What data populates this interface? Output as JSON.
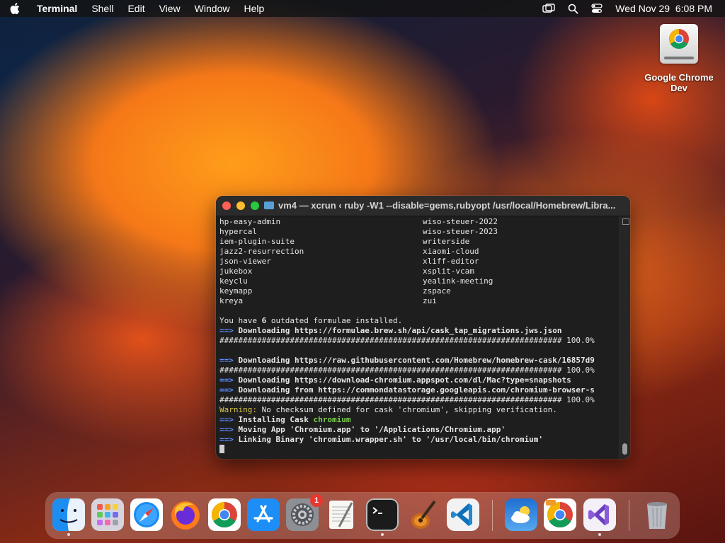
{
  "menubar": {
    "app_name": "Terminal",
    "menus": [
      "Shell",
      "Edit",
      "View",
      "Window",
      "Help"
    ],
    "clock": "Wed Nov 29  6:08 PM"
  },
  "desktop": {
    "icons": [
      {
        "label": "Google Chrome Dev",
        "icon": "chrome-dev-drive-icon"
      }
    ]
  },
  "terminal": {
    "title": "vm4 — xcrun ‹ ruby -W1 --disable=gems,rubyopt /usr/local/Homebrew/Libra...",
    "columns_rows": [
      [
        "hp-easy-admin",
        "wiso-steuer-2022"
      ],
      [
        "hypercal",
        "wiso-steuer-2023"
      ],
      [
        "iem-plugin-suite",
        "writerside"
      ],
      [
        "jazz2-resurrection",
        "xiaomi-cloud"
      ],
      [
        "json-viewer",
        "xliff-editor"
      ],
      [
        "jukebox",
        "xsplit-vcam"
      ],
      [
        "keyclu",
        "yealink-meeting"
      ],
      [
        "keymapp",
        "zspace"
      ],
      [
        "kreya",
        "zui"
      ]
    ],
    "outdated_prefix": "You have ",
    "outdated_count": "6",
    "outdated_suffix": " outdated formulae installed.",
    "arrow": "==>",
    "dl1": "Downloading https://formulae.brew.sh/api/cask_tap_migrations.jws.json",
    "progress_bar": "######################################################################### 100.0%",
    "dl2": "Downloading https://raw.githubusercontent.com/Homebrew/homebrew-cask/16857d9",
    "dl3": "Downloading https://download-chromium.appspot.com/dl/Mac?type=snapshots",
    "dl4": "Downloading from https://commondatastorage.googleapis.com/chromium-browser-s",
    "warning_label": "Warning:",
    "warning_text": " No checksum defined for cask 'chromium', skipping verification.",
    "install_label": "Installing Cask ",
    "install_name": "chromium",
    "moving": "Moving App 'Chromium.app' to '/Applications/Chromium.app'",
    "linking": "Linking Binary 'chromium.wrapper.sh' to '/usr/local/bin/chromium'"
  },
  "dock": {
    "items": [
      {
        "name": "Finder",
        "icon": "finder-icon",
        "running": true
      },
      {
        "name": "Launchpad",
        "icon": "launchpad-icon"
      },
      {
        "name": "Safari",
        "icon": "safari-icon"
      },
      {
        "name": "Firefox",
        "icon": "firefox-icon"
      },
      {
        "name": "Google Chrome",
        "icon": "chrome-icon"
      },
      {
        "name": "App Store",
        "icon": "app-store-icon"
      },
      {
        "name": "System Settings",
        "icon": "settings-icon",
        "badge": "1"
      },
      {
        "name": "TextEdit",
        "icon": "textedit-icon"
      },
      {
        "name": "Terminal",
        "icon": "terminal-icon",
        "running": true
      },
      {
        "name": "GarageBand",
        "icon": "garageband-icon"
      },
      {
        "name": "Visual Studio Code",
        "icon": "vscode-icon"
      },
      {
        "name": "Weather",
        "icon": "weather-icon"
      },
      {
        "name": "Google Chrome Dev",
        "icon": "chrome-dev-icon"
      },
      {
        "name": "Visual Studio",
        "icon": "visual-studio-icon",
        "running": true
      },
      {
        "name": "Trash",
        "icon": "trash-icon"
      }
    ]
  },
  "colors": {
    "terminal_bg": "#1e1e1e",
    "arrow_blue": "#5a8cff",
    "warning_yellow": "#d8c64a",
    "cask_green": "#7bd34a"
  }
}
